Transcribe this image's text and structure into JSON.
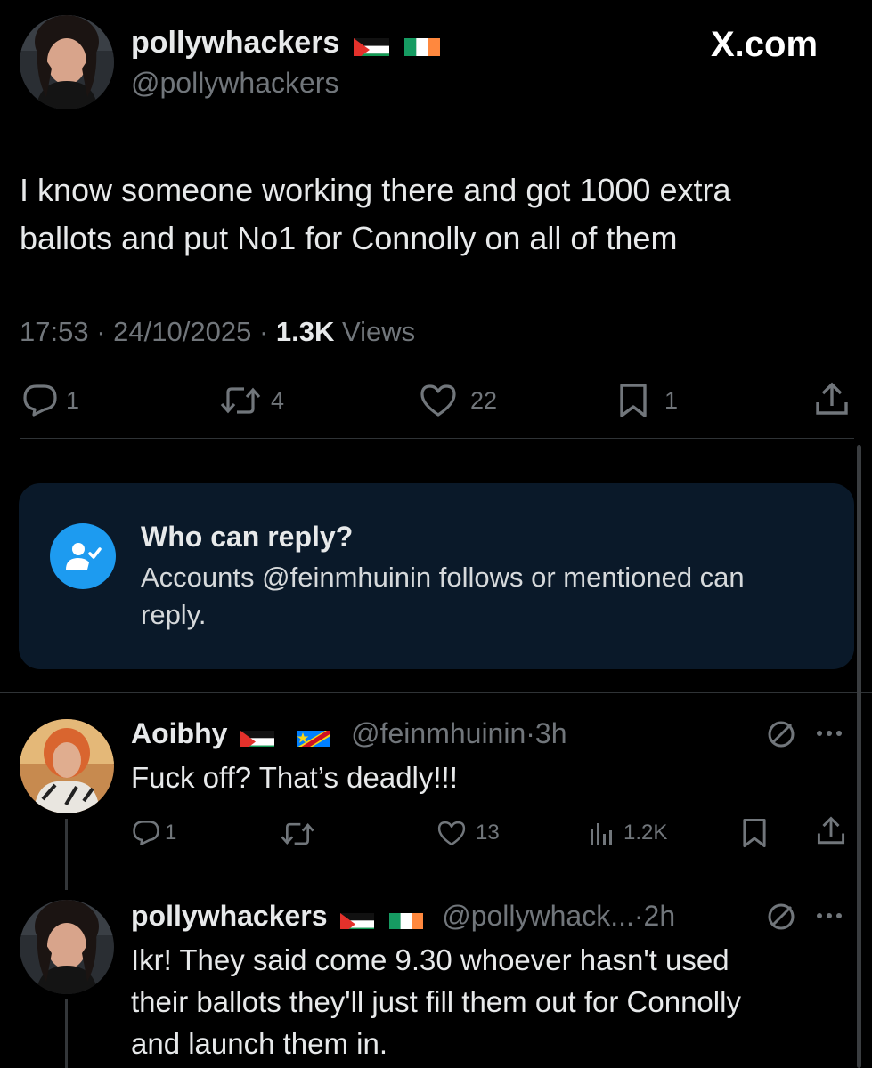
{
  "main_tweet": {
    "display_name": "pollywhackers",
    "handle": "@pollywhackers",
    "brand": "X.com",
    "flags": [
      "palestine-flag",
      "ireland-flag"
    ],
    "text_line1": "I know someone working there and got 1000 extra",
    "text_line2": "ballots and put No1 for Connolly on all of them",
    "time": "17:53",
    "date": "24/10/2025",
    "views_count": "1.3K",
    "views_label": "Views",
    "sep": "·",
    "actions": {
      "replies": "1",
      "reposts": "4",
      "likes": "22",
      "bookmarks": "1"
    }
  },
  "reply_notice": {
    "title": "Who can reply?",
    "line1": "Accounts @feinmhuinin follows or mentioned can",
    "line2": "reply.",
    "icon": "person-check-icon"
  },
  "replies": [
    {
      "display_name": "Aoibhy",
      "flags": [
        "palestine-flag",
        "dr-congo-flag"
      ],
      "handle": "@feinmhuinin",
      "time": "3h",
      "text": "Fuck off? That’s deadly!!!",
      "actions": {
        "replies": "1",
        "reposts": "",
        "likes": "13",
        "views": "1.2K"
      }
    },
    {
      "display_name": "pollywhackers",
      "flags": [
        "palestine-flag",
        "ireland-flag"
      ],
      "handle": "@pollywhack...",
      "time": "2h",
      "text_line1": "Ikr! They said come 9.30 whoever hasn't used",
      "text_line2": "their ballots they'll just fill them out for Connolly",
      "text_line3": "and launch them in."
    }
  ],
  "colors": {
    "background": "#000000",
    "text": "#e7e9ea",
    "muted": "#71767b",
    "accent": "#1d9bf0",
    "notice_bg": "#0a1929"
  }
}
